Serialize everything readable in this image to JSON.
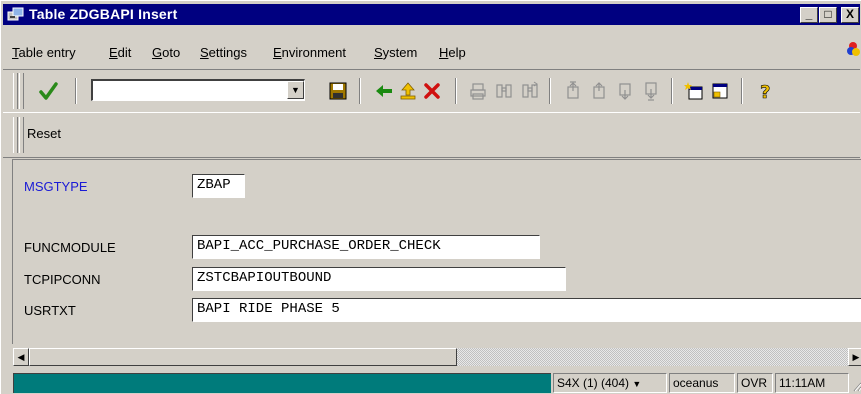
{
  "window": {
    "title": "Table ZDGBAPI Insert",
    "minimize_label": "_",
    "maximize_label": "□",
    "close_label": "X"
  },
  "menubar": {
    "items": [
      {
        "label_first": "T",
        "label_rest": "able entry"
      },
      {
        "label_first": "E",
        "label_rest": "dit"
      },
      {
        "label_first": "G",
        "label_rest": "oto"
      },
      {
        "label_first": "S",
        "label_rest": "ettings"
      },
      {
        "label_first": "E",
        "label_rest": "nvironment"
      },
      {
        "label_first": "S",
        "label_rest": "ystem"
      },
      {
        "label_first": "H",
        "label_rest": "elp"
      }
    ]
  },
  "toolbar": {
    "command_field_value": "",
    "icons": [
      "enter-check-icon",
      "save-icon",
      "back-icon",
      "exit-icon",
      "cancel-icon",
      "print-icon",
      "find-icon",
      "find-next-icon",
      "first-page-icon",
      "previous-page-icon",
      "next-page-icon",
      "last-page-icon",
      "create-session-icon",
      "shortcut-icon",
      "help-icon"
    ]
  },
  "app_toolbar": {
    "reset_label": "Reset"
  },
  "fields": [
    {
      "label": "MSGTYPE",
      "value": "ZBAP",
      "key": true
    },
    {
      "label": "FUNCMODULE",
      "value": "BAPI_ACC_PURCHASE_ORDER_CHECK",
      "key": false
    },
    {
      "label": "TCPIPCONN",
      "value": "ZSTCBAPIOUTBOUND",
      "key": false
    },
    {
      "label": "USRTXT",
      "value": "BAPI RIDE PHASE 5",
      "key": false
    }
  ],
  "statusbar": {
    "system": "S4X (1) (404)",
    "server": "oceanus",
    "mode": "OVR",
    "time": "11:11AM"
  },
  "colors": {
    "titlebar": "#000080",
    "key_label": "#1a1ad6",
    "status_message": "#007b7b",
    "window_bg": "#d4d0c8"
  }
}
